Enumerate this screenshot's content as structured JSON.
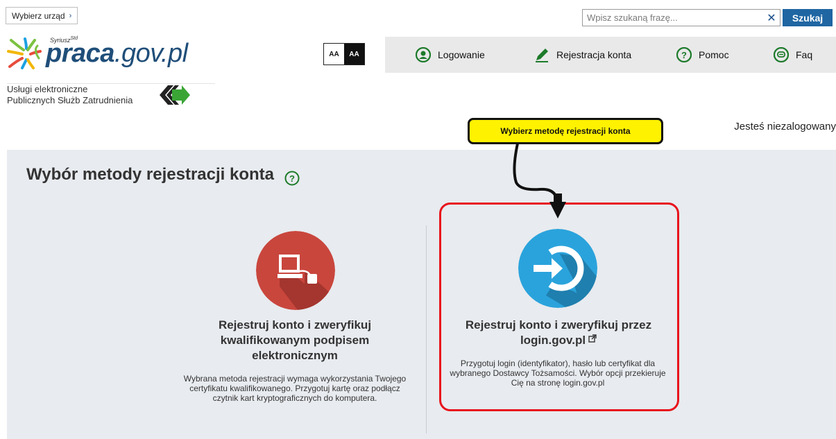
{
  "top": {
    "urzad_label": "Wybierz urząd",
    "search_placeholder": "Wpisz szukaną frazę...",
    "search_button": "Szukaj"
  },
  "logo": {
    "sup": "Syriusz",
    "sup_std": "Std",
    "word_main": "praca",
    "word_ext": ".gov.pl",
    "subtitle_line1": "Usługi elektroniczne",
    "subtitle_line2": "Publicznych Służb Zatrudnienia"
  },
  "contrast": {
    "normal": "AA",
    "high": "AA"
  },
  "nav": {
    "login": "Logowanie",
    "register": "Rejestracja konta",
    "help": "Pomoc",
    "faq": "Faq"
  },
  "status": "Jesteś niezalogowany",
  "callout": "Wybierz metodę rejestracji konta",
  "main": {
    "title": "Wybór metody rejestracji konta",
    "option1": {
      "title": "Rejestruj konto i zweryfikuj kwalifikowanym podpisem elektronicznym",
      "desc": "Wybrana metoda rejestracji wymaga wykorzystania Twojego certyfikatu kwalifikowanego. Przygotuj kartę oraz podłącz czytnik kart kryptograficznych do komputera."
    },
    "option2": {
      "title": "Rejestruj konto i zweryfikuj przez login.gov.pl",
      "desc": "Przygotuj login (identyfikator), hasło lub certyfikat dla wybranego Dostawcy Tożsamości. Wybór opcji przekieruje Cię na stronę login.gov.pl"
    }
  },
  "colors": {
    "option1_circle": "#c9463d",
    "option2_circle": "#2aa3dc",
    "highlight": "#e8141c",
    "callout": "#fff200",
    "search_button": "#1f66a3"
  }
}
